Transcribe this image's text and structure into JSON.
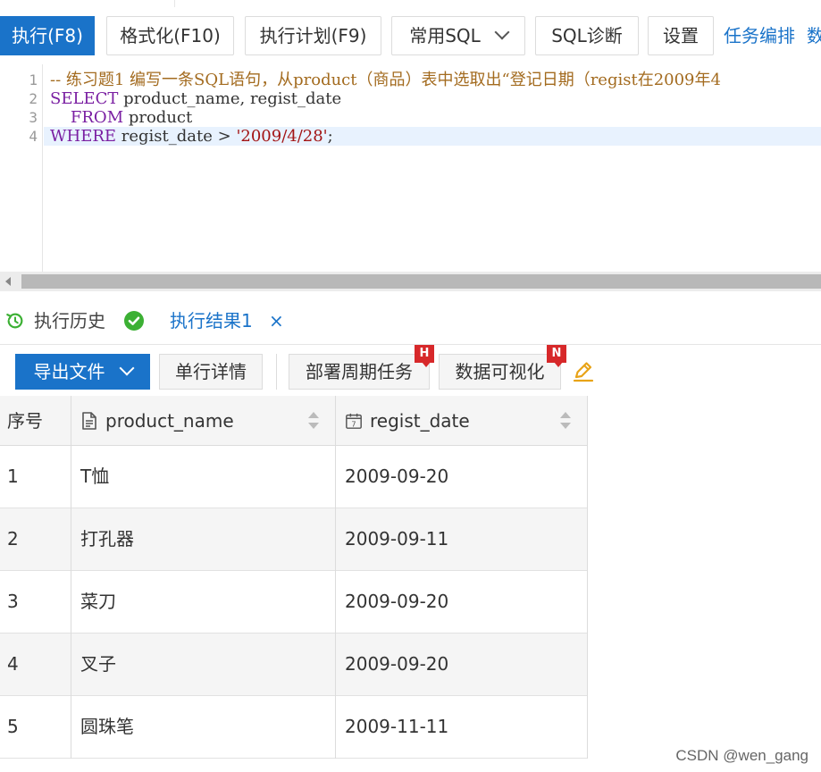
{
  "toolbar": {
    "execute": "执行(F8)",
    "format": "格式化(F10)",
    "plan": "执行计划(F9)",
    "common_sql": "常用SQL",
    "diagnose": "SQL诊断",
    "settings": "设置",
    "task_schedule": "任务编排",
    "overflow": "数"
  },
  "editor": {
    "line_numbers": [
      "1",
      "2",
      "3",
      "4"
    ],
    "line1_comment": "-- 练习题1 编写一条SQL语句，从product（商品）表中选取出“登记日期（regist在2009年4",
    "line2_kw": "SELECT",
    "line2_rest": " product_name, regist_date",
    "line3_indent": "    ",
    "line3_kw": "FROM",
    "line3_rest": " product",
    "line4_kw": "WHERE",
    "line4_mid": " regist_date > ",
    "line4_str": "'2009/4/28'",
    "line4_end": ";"
  },
  "tabs": {
    "history": "执行历史",
    "result": "执行结果1",
    "close": "×"
  },
  "result_toolbar": {
    "export": "导出文件",
    "row_detail": "单行详情",
    "deploy_task": "部署周期任务",
    "deploy_badge": "H",
    "visualize": "数据可视化",
    "visualize_badge": "N"
  },
  "table": {
    "headers": [
      "序号",
      "product_name",
      "regist_date"
    ],
    "rows": [
      [
        "1",
        "T恤",
        "2009-09-20"
      ],
      [
        "2",
        "打孔器",
        "2009-09-11"
      ],
      [
        "3",
        "菜刀",
        "2009-09-20"
      ],
      [
        "4",
        "叉子",
        "2009-09-20"
      ],
      [
        "5",
        "圆珠笔",
        "2009-11-11"
      ]
    ]
  },
  "watermark": "CSDN @wen_gang",
  "colors": {
    "accent": "#1a73c9",
    "badge_red": "#d7282a",
    "success_green": "#3cb034",
    "edit_orange": "#e8a317"
  }
}
